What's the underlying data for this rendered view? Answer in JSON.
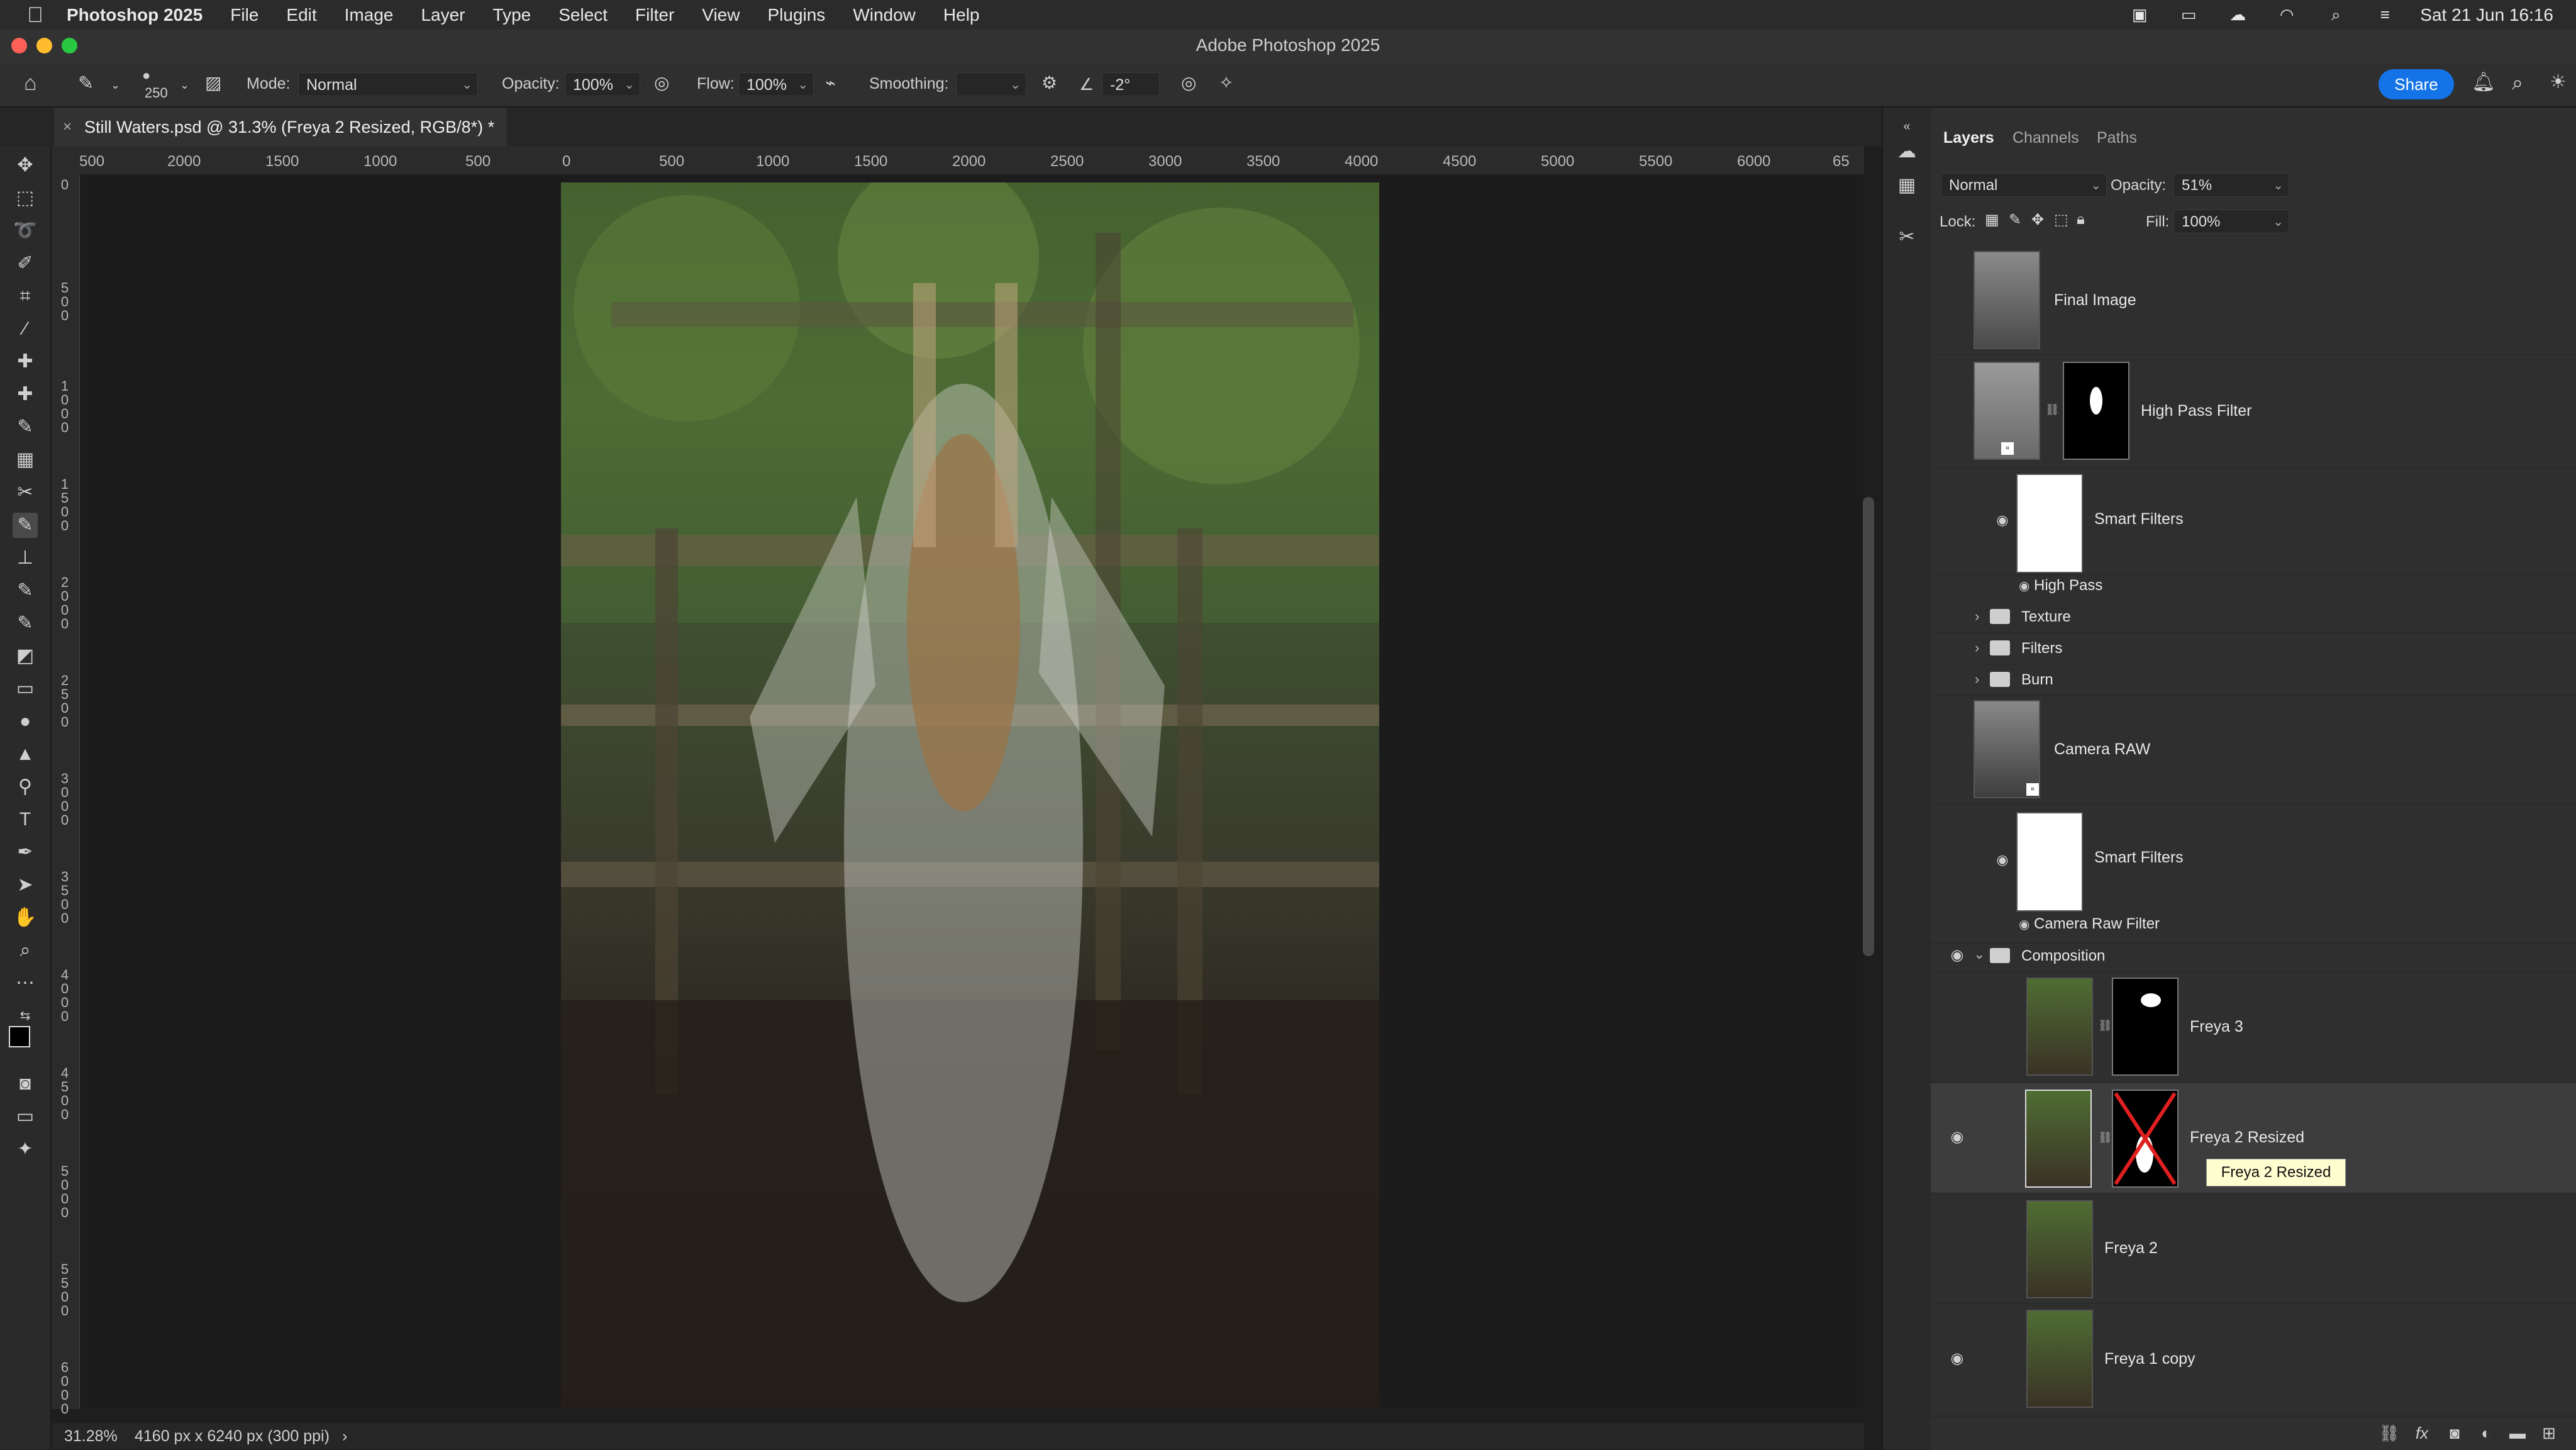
{
  "menubar": {
    "app_name": "Photoshop 2025",
    "items": [
      "File",
      "Edit",
      "Image",
      "Layer",
      "Type",
      "Select",
      "Filter",
      "View",
      "Plugins",
      "Window",
      "Help"
    ],
    "clock": "Sat 21 Jun  16:16"
  },
  "window": {
    "title": "Adobe Photoshop 2025"
  },
  "options": {
    "brush_size": "250",
    "mode_label": "Mode:",
    "mode_value": "Normal",
    "opacity_label": "Opacity:",
    "opacity_value": "100%",
    "flow_label": "Flow:",
    "flow_value": "100%",
    "smoothing_label": "Smoothing:",
    "smoothing_value": "",
    "angle_value": "-2°",
    "share_label": "Share"
  },
  "document": {
    "tab_title": "Still Waters.psd @ 31.3% (Freya 2 Resized, RGB/8*) *",
    "zoom": "31.28%",
    "size_info": "4160 px x 6240 px (300 ppi)",
    "status_arrow": "›"
  },
  "rulers": {
    "h_ticks": [
      "500",
      "2000",
      "1500",
      "1000",
      "500",
      "0",
      "500",
      "1000",
      "1500",
      "2000",
      "2500",
      "3000",
      "3500",
      "4000",
      "4500",
      "5000",
      "5500",
      "6000",
      "65"
    ],
    "v_ticks": [
      "0",
      "500",
      "1000",
      "1500",
      "2000",
      "2500",
      "3000",
      "3500",
      "4000",
      "4500",
      "5000",
      "5500",
      "6000"
    ]
  },
  "panel": {
    "tabs": [
      "Layers",
      "Channels",
      "Paths"
    ],
    "blend_mode": "Normal",
    "opacity_label": "Opacity:",
    "opacity_value": "51%",
    "lock_label": "Lock:",
    "fill_label": "Fill:",
    "fill_value": "100%",
    "layers": {
      "final_image": "Final Image",
      "high_pass_filter": "High Pass Filter",
      "smart_filters_1": "Smart Filters",
      "high_pass": "High Pass",
      "texture": "Texture",
      "filters": "Filters",
      "burn": "Burn",
      "camera_raw": "Camera RAW",
      "smart_filters_2": "Smart Filters",
      "camera_raw_filter": "Camera Raw Filter",
      "composition": "Composition",
      "freya_3": "Freya 3",
      "freya_2_resized": "Freya 2 Resized",
      "freya_2": "Freya 2",
      "freya_1_copy": "Freya 1 copy"
    },
    "tooltip": "Freya 2 Resized"
  },
  "colors": {
    "accent": "#1473e6",
    "selected_row": "#3d3d3d",
    "mask_disabled_x": "#e02020"
  }
}
